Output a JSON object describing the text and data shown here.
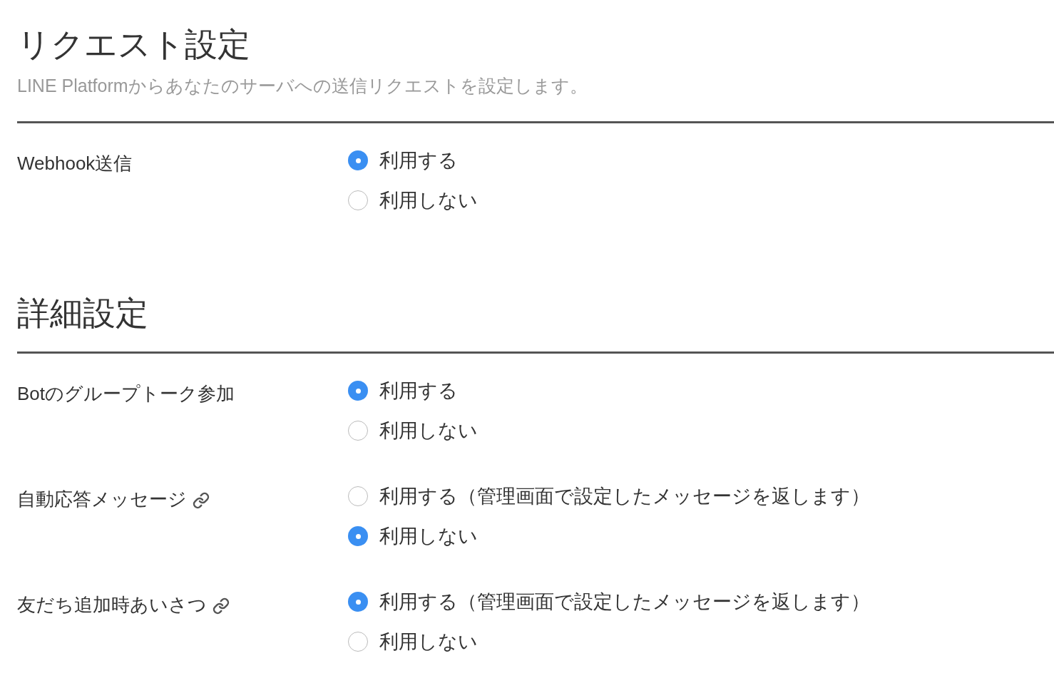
{
  "sections": [
    {
      "title": "リクエスト設定",
      "description": "LINE Platformからあなたのサーバへの送信リクエストを設定します。",
      "settings": [
        {
          "label": "Webhook送信",
          "link": false,
          "options": [
            {
              "label": "利用する",
              "selected": true
            },
            {
              "label": "利用しない",
              "selected": false
            }
          ]
        }
      ]
    },
    {
      "title": "詳細設定",
      "settings": [
        {
          "label": "Botのグループトーク参加",
          "link": false,
          "options": [
            {
              "label": "利用する",
              "selected": true
            },
            {
              "label": "利用しない",
              "selected": false
            }
          ]
        },
        {
          "label": "自動応答メッセージ",
          "link": true,
          "options": [
            {
              "label": "利用する（管理画面で設定したメッセージを返します）",
              "selected": false
            },
            {
              "label": "利用しない",
              "selected": true
            }
          ]
        },
        {
          "label": "友だち追加時あいさつ",
          "link": true,
          "options": [
            {
              "label": "利用する（管理画面で設定したメッセージを返します）",
              "selected": true
            },
            {
              "label": "利用しない",
              "selected": false
            }
          ]
        }
      ]
    }
  ]
}
